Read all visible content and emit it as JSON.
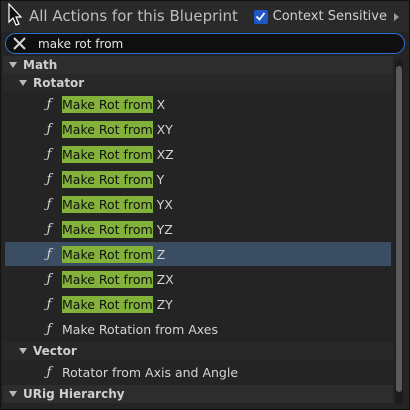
{
  "header": {
    "title": "All Actions for this Blueprint",
    "context_label": "Context Sensitive",
    "context_checked": true
  },
  "search": {
    "value": "make rot from"
  },
  "categories": {
    "math": "Math",
    "rotator": "Rotator",
    "vector": "Vector",
    "urig": "URig Hierarchy"
  },
  "rotator_items": [
    {
      "match": "Make Rot from",
      "rest": " X"
    },
    {
      "match": "Make Rot from",
      "rest": " XY"
    },
    {
      "match": "Make Rot from",
      "rest": " XZ"
    },
    {
      "match": "Make Rot from",
      "rest": " Y"
    },
    {
      "match": "Make Rot from",
      "rest": " YX"
    },
    {
      "match": "Make Rot from",
      "rest": " YZ"
    },
    {
      "match": "Make Rot from",
      "rest": " Z",
      "selected": true
    },
    {
      "match": "Make Rot from",
      "rest": " ZX"
    },
    {
      "match": "Make Rot from",
      "rest": " ZY"
    },
    {
      "match": "",
      "rest": "Make Rotation from Axes"
    }
  ],
  "vector_items": [
    {
      "match": "",
      "rest": "Rotator from Axis and Angle"
    }
  ],
  "colors": {
    "highlight": "#83b23a",
    "selected_row": "#3b4d63",
    "accent": "#2e6fd0"
  },
  "icons": {
    "function": "ƒ"
  }
}
